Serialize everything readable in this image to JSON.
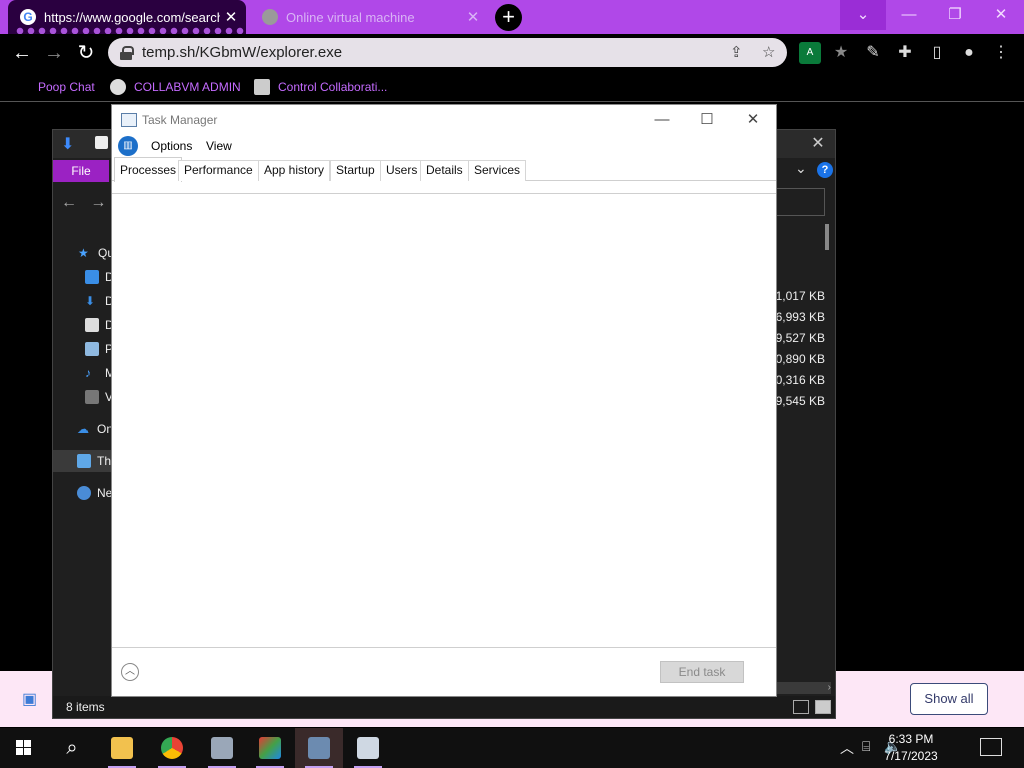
{
  "browser": {
    "tabs": [
      {
        "title": "https://www.google.com/search?",
        "active": true
      },
      {
        "title": "Online virtual machine",
        "active": false
      }
    ],
    "address": "temp.sh/KGbmW/explorer.exe",
    "bookmarks": [
      "Poop Chat",
      "COLLABVM ADMIN",
      "Control Collaborati..."
    ],
    "accent_color": "#b048e8"
  },
  "notification": {
    "show_all_label": "Show all"
  },
  "explorer": {
    "file_tab": "File",
    "tree": [
      "Qu",
      "D",
      "D",
      "D",
      "P",
      "M",
      "V",
      "On",
      "Thi",
      "Ne"
    ],
    "sizes": [
      "1,017 KB",
      "6,993 KB",
      "9,527 KB",
      "0,890 KB",
      "0,316 KB",
      "9,545 KB"
    ],
    "status": "8 items"
  },
  "taskmanager": {
    "title": "Task Manager",
    "menus": [
      "Options",
      "View"
    ],
    "tabs": [
      "Processes",
      "Performance",
      "App history",
      "Startup",
      "Users",
      "Details",
      "Services"
    ],
    "active_tab": "Processes",
    "end_task_label": "End task"
  },
  "taskbar": {
    "time": "6:33 PM",
    "date": "7/17/2023"
  }
}
